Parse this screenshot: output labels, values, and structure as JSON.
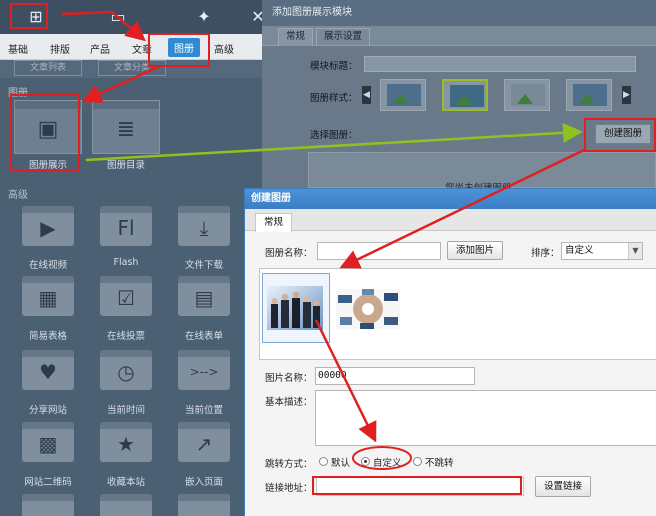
{
  "left_panel": {
    "top_icons": [
      "add-module-icon",
      "page-icon",
      "magic-wand-icon",
      "close-icon"
    ],
    "category_tabs": [
      "基础",
      "排版",
      "产品",
      "文章",
      "图册",
      "高级"
    ],
    "active_tab": "图册",
    "collapsed_tabs": [
      "文章列表",
      "文章分类"
    ],
    "album_section": {
      "title": "图册",
      "items": [
        {
          "label": "图册展示",
          "icon": "image-gallery-icon",
          "glyph": "▣"
        },
        {
          "label": "图册目录",
          "icon": "list-icon",
          "glyph": "≣"
        }
      ]
    },
    "advanced_section": {
      "title": "高级",
      "items": [
        {
          "label": "在线视频",
          "icon": "play-icon",
          "glyph": "▶"
        },
        {
          "label": "Flash",
          "icon": "flash-icon",
          "glyph": "Fl"
        },
        {
          "label": "文件下载",
          "icon": "download-icon",
          "glyph": "⤓"
        },
        {
          "label": "简易表格",
          "icon": "table-icon",
          "glyph": "▦"
        },
        {
          "label": "在线投票",
          "icon": "vote-icon",
          "glyph": "☑"
        },
        {
          "label": "在线表单",
          "icon": "form-icon",
          "glyph": "▤"
        },
        {
          "label": "分享网站",
          "icon": "heart-icon",
          "glyph": "♥"
        },
        {
          "label": "当前时间",
          "icon": "clock-icon",
          "glyph": "◷"
        },
        {
          "label": "当前位置",
          "icon": "breadcrumb-icon",
          "glyph": ">-->"
        },
        {
          "label": "网站二维码",
          "icon": "qr-code-icon",
          "glyph": "▩"
        },
        {
          "label": "收藏本站",
          "icon": "star-icon",
          "glyph": "★"
        },
        {
          "label": "嵌入页面",
          "icon": "embed-icon",
          "glyph": "↗"
        }
      ]
    }
  },
  "bg_dialog": {
    "title": "添加图册展示模块",
    "tabs": [
      "常规",
      "展示设置"
    ],
    "module_title_label": "模块标题：",
    "album_style_label": "图册样式：",
    "select_album_label": "选择图册：",
    "create_album_button": "创建图册",
    "empty_text": "您尚未创建图册"
  },
  "dialog": {
    "title": "创建图册",
    "tab": "常规",
    "album_name_label": "图册名称：",
    "album_name_value": "",
    "add_image_button": "添加图片",
    "sort_label": "排序：",
    "sort_value": "自定义",
    "image_name_label": "图片名称：",
    "image_name_value": "00000",
    "description_label": "基本描述：",
    "jump_label": "跳转方式：",
    "jump_options": [
      "默认",
      "自定义",
      "不跳转"
    ],
    "jump_selected": "自定义",
    "link_label": "链接地址：",
    "link_value": "",
    "set_link_button": "设置链接"
  },
  "colors": {
    "annotation_red": "#e02020",
    "annotation_green": "#8ec21f",
    "dialog_title_blue": "#3a7fc5"
  }
}
